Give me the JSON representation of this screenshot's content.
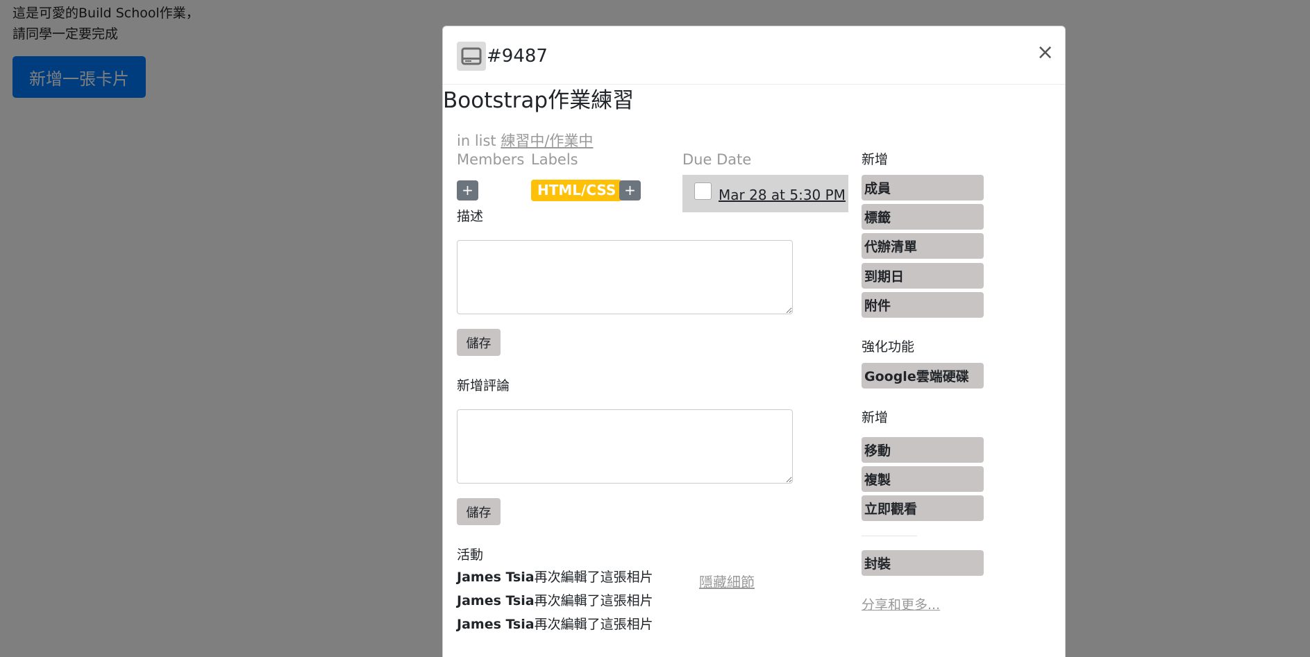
{
  "background": {
    "line1": "這是可愛的Build School作業，",
    "line2": "請同學一定要完成",
    "add_card_button": "新增一張卡片"
  },
  "modal": {
    "card_id": "#9487",
    "close_glyph": "×",
    "title": "Bootstrap作業練習",
    "in_list_prefix": "in list ",
    "in_list_name": "練習中/作業中",
    "members_label": "Members",
    "labels_label": "Labels",
    "due_date_label": "Due Date",
    "plus_glyph": "+",
    "tag": "HTML/CSS",
    "tag_color": "#ffc107",
    "due_date_value": "Mar 28 at 5:30 PM",
    "description_label": "描述",
    "save_label": "儲存",
    "comment_label": "新增評論",
    "activity_label": "活動",
    "hide_details": "隱藏細節",
    "activities": [
      {
        "user": "James Tsia",
        "action": "再次編輯了這張相片"
      },
      {
        "user": "James Tsia",
        "action": "再次編輯了這張相片"
      },
      {
        "user": "James Tsia",
        "action": "再次編輯了這張相片"
      }
    ]
  },
  "sidebar": {
    "add_heading": "新增",
    "add_items": [
      "成員",
      "標籤",
      "代辦清單",
      "到期日",
      "附件"
    ],
    "powerups_heading": "強化功能",
    "powerups_items": [
      "Google雲端硬碟"
    ],
    "actions_heading": "新增",
    "actions_items": [
      "移動",
      "複製",
      "立即觀看"
    ],
    "archive": "封裝",
    "share_more": "分享和更多..."
  },
  "colors": {
    "primary": "#007bff",
    "secondary": "#6c757d",
    "sidebar_button": "#c8c4c4",
    "overlay": "rgba(0,0,0,0.5)"
  },
  "icons": {
    "card": "card-icon",
    "close": "close-icon",
    "plus": "plus-icon"
  }
}
